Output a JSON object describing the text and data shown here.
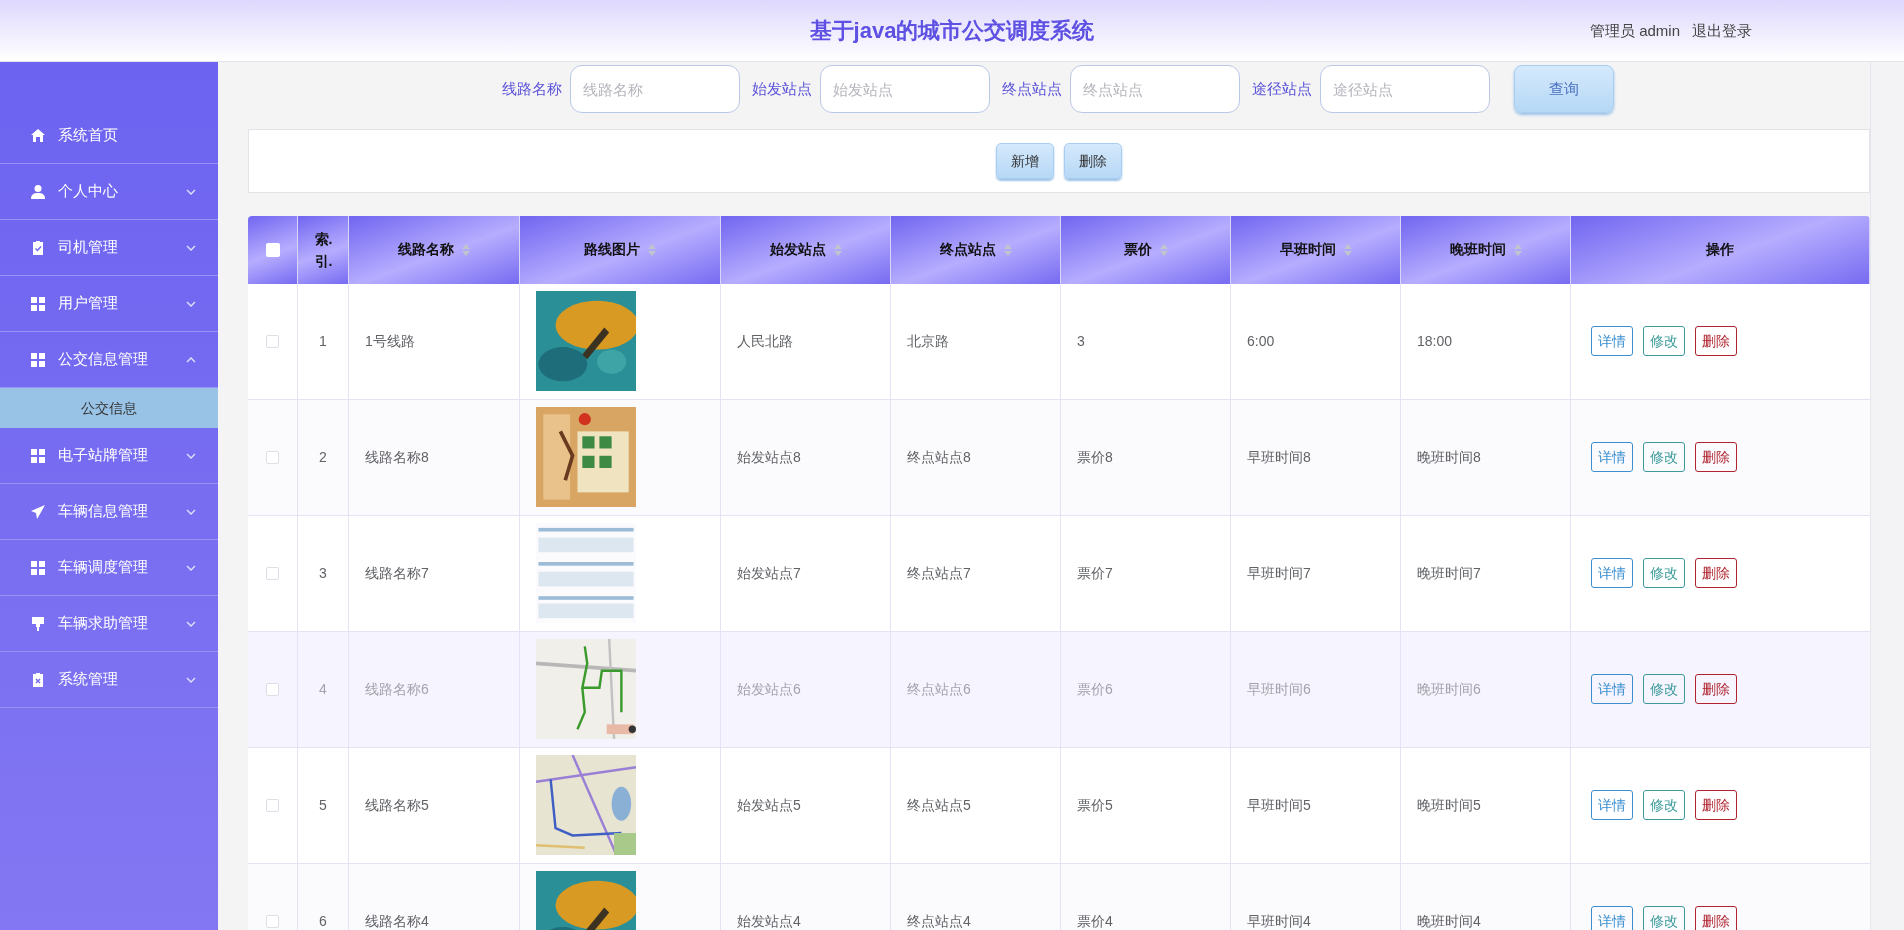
{
  "header": {
    "title": "基于java的城市公交调度系统",
    "user": "管理员 admin",
    "logout": "退出登录"
  },
  "sidebar": {
    "items": [
      {
        "label": "系统首页",
        "kind": "link",
        "expanded": false
      },
      {
        "label": "个人中心",
        "kind": "menu",
        "expanded": false
      },
      {
        "label": "司机管理",
        "kind": "menu",
        "expanded": false
      },
      {
        "label": "用户管理",
        "kind": "menu",
        "expanded": false
      },
      {
        "label": "公交信息管理",
        "kind": "menu",
        "expanded": true,
        "children": [
          {
            "label": "公交信息",
            "selected": true
          }
        ]
      },
      {
        "label": "电子站牌管理",
        "kind": "menu",
        "expanded": false
      },
      {
        "label": "车辆信息管理",
        "kind": "menu",
        "expanded": false
      },
      {
        "label": "车辆调度管理",
        "kind": "menu",
        "expanded": false
      },
      {
        "label": "车辆求助管理",
        "kind": "menu",
        "expanded": false
      },
      {
        "label": "系统管理",
        "kind": "menu",
        "expanded": false
      }
    ]
  },
  "search": {
    "fields": [
      {
        "label": "线路名称",
        "placeholder": "线路名称"
      },
      {
        "label": "始发站点",
        "placeholder": "始发站点"
      },
      {
        "label": "终点站点",
        "placeholder": "终点站点"
      },
      {
        "label": "途径站点",
        "placeholder": "途径站点"
      }
    ],
    "button": "查询"
  },
  "actions": [
    "新增",
    "删除"
  ],
  "table": {
    "select_all_checked": false,
    "columns": [
      {
        "label": "索.引.",
        "sortable": false
      },
      {
        "label": "线路名称",
        "sortable": true
      },
      {
        "label": "路线图片",
        "sortable": true
      },
      {
        "label": "始发站点",
        "sortable": true
      },
      {
        "label": "终点站点",
        "sortable": true
      },
      {
        "label": "票价",
        "sortable": true
      },
      {
        "label": "早班时间",
        "sortable": true
      },
      {
        "label": "晚班时间",
        "sortable": true
      },
      {
        "label": "操作",
        "sortable": false
      }
    ],
    "rows": [
      {
        "checked": false,
        "index": "1",
        "name": "1号线路",
        "start": "人民北路",
        "end": "北京路",
        "price": "3",
        "morning": "6:00",
        "evening": "18:00",
        "hovered": false,
        "buttons": [
          {
            "label": "详情",
            "kind": "detail"
          },
          {
            "label": "修改",
            "kind": "edit"
          },
          {
            "label": "删除",
            "kind": "delete"
          }
        ]
      },
      {
        "checked": false,
        "index": "2",
        "name": "线路名称8",
        "start": "始发站点8",
        "end": "终点站点8",
        "price": "票价8",
        "morning": "早班时间8",
        "evening": "晚班时间8",
        "hovered": false,
        "buttons": [
          {
            "label": "详情",
            "kind": "detail"
          },
          {
            "label": "修改",
            "kind": "edit"
          },
          {
            "label": "删除",
            "kind": "delete"
          }
        ]
      },
      {
        "checked": false,
        "index": "3",
        "name": "线路名称7",
        "start": "始发站点7",
        "end": "终点站点7",
        "price": "票价7",
        "morning": "早班时间7",
        "evening": "晚班时间7",
        "hovered": false,
        "buttons": [
          {
            "label": "详情",
            "kind": "detail"
          },
          {
            "label": "修改",
            "kind": "edit"
          },
          {
            "label": "删除",
            "kind": "delete"
          }
        ]
      },
      {
        "checked": false,
        "index": "4",
        "name": "线路名称6",
        "start": "始发站点6",
        "end": "终点站点6",
        "price": "票价6",
        "morning": "早班时间6",
        "evening": "晚班时间6",
        "hovered": true,
        "buttons": [
          {
            "label": "详情",
            "kind": "detail"
          },
          {
            "label": "修改",
            "kind": "edit"
          },
          {
            "label": "删除",
            "kind": "delete"
          }
        ]
      },
      {
        "checked": false,
        "index": "5",
        "name": "线路名称5",
        "start": "始发站点5",
        "end": "终点站点5",
        "price": "票价5",
        "morning": "早班时间5",
        "evening": "晚班时间5",
        "hovered": false,
        "buttons": [
          {
            "label": "详情",
            "kind": "detail"
          },
          {
            "label": "修改",
            "kind": "edit"
          },
          {
            "label": "删除",
            "kind": "delete"
          }
        ]
      },
      {
        "checked": false,
        "index": "6",
        "name": "线路名称4",
        "start": "始发站点4",
        "end": "终点站点4",
        "price": "票价4",
        "morning": "早班时间4",
        "evening": "晚班时间4",
        "hovered": false,
        "buttons": [
          {
            "label": "详情",
            "kind": "detail"
          },
          {
            "label": "修改",
            "kind": "edit"
          },
          {
            "label": "删除",
            "kind": "delete"
          }
        ]
      }
    ]
  }
}
